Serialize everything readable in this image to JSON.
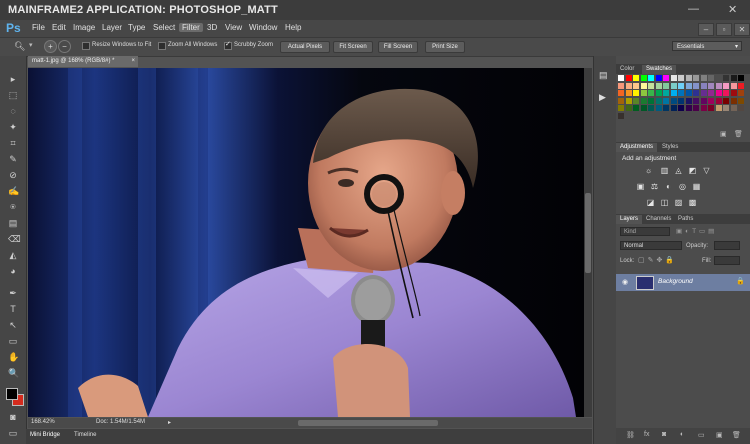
{
  "window": {
    "title": "MAINFRAME2 APPLICATION: PHOTOSHOP_MATT",
    "minimize": "—",
    "close": "✕"
  },
  "app_logo": "Ps",
  "menu": [
    "File",
    "Edit",
    "Image",
    "Layer",
    "Type",
    "Select",
    "Filter",
    "3D",
    "View",
    "Window",
    "Help"
  ],
  "menu_active": "Filter",
  "options": {
    "resize_windows": "Resize Windows to Fit",
    "zoom_all": "Zoom All Windows",
    "scrubby_zoom": "Scrubby Zoom",
    "actual_pixels": "Actual Pixels",
    "fit_screen": "Fit Screen",
    "fill_screen": "Fill Screen",
    "print_size": "Print Size",
    "workspace": "Essentials"
  },
  "document": {
    "tab_label": "matt-1.jpg @ 168% (RGB/8#) *",
    "close": "×",
    "zoom": "168.42%",
    "doc_size": "Doc: 1.54M/1.54M"
  },
  "bottom_tabs": [
    "Mini Bridge",
    "Timeline"
  ],
  "swatches_panel": {
    "tabs": [
      "Color",
      "Swatches"
    ],
    "colors": [
      "#ffffff",
      "#ff0000",
      "#ffff00",
      "#00ff00",
      "#00ffff",
      "#0000ff",
      "#ff00ff",
      "#e6e6e6",
      "#cccccc",
      "#b3b3b3",
      "#999999",
      "#808080",
      "#666666",
      "#4d4d4d",
      "#333333",
      "#1a1a1a",
      "#000000",
      "#f7977a",
      "#f9ad81",
      "#fdc68a",
      "#fff79a",
      "#c4df9b",
      "#a2d39c",
      "#82ca9d",
      "#7bcdc8",
      "#6ecff6",
      "#7ea7d8",
      "#8493ca",
      "#8882be",
      "#a187be",
      "#bc8dbf",
      "#f49ac2",
      "#f6989d",
      "#ed1c24",
      "#f26522",
      "#f7941d",
      "#fff200",
      "#8dc63f",
      "#39b54a",
      "#00a651",
      "#00a99d",
      "#00aeef",
      "#0072bc",
      "#0054a6",
      "#2e3192",
      "#662d91",
      "#92278f",
      "#ec008c",
      "#ed145b",
      "#9e0b0f",
      "#a0410d",
      "#a36209",
      "#aba000",
      "#598527",
      "#1a7b30",
      "#007236",
      "#00746b",
      "#0076a3",
      "#004b80",
      "#003471",
      "#1b1464",
      "#440e62",
      "#630460",
      "#9e005d",
      "#9e0039",
      "#790000",
      "#7b2e00",
      "#7d4900",
      "#827b00",
      "#406618",
      "#005e20",
      "#005826",
      "#005952",
      "#005b7f",
      "#003663",
      "#002157",
      "#0d004c",
      "#32004b",
      "#4b0049",
      "#7b0046",
      "#7a0026",
      "#c69c6d",
      "#998675",
      "#736357",
      "#534741",
      "#37302d"
    ]
  },
  "adjustments_panel": {
    "tabs": [
      "Adjustments",
      "Styles"
    ],
    "heading": "Add an adjustment",
    "row1": [
      "☼",
      "▥",
      "◬",
      "◩",
      "▽"
    ],
    "row2": [
      "▣",
      "⚖",
      "◐",
      "◎",
      "▦"
    ],
    "row3": [
      "◪",
      "◫",
      "▨",
      "▩"
    ]
  },
  "layers_panel": {
    "tabs": [
      "Layers",
      "Channels",
      "Paths"
    ],
    "kind": "Kind",
    "blend_mode": "Normal",
    "opacity_label": "Opacity:",
    "lock_label": "Lock:",
    "fill_label": "Fill:",
    "layer_name": "Background",
    "footer": [
      "⛓",
      "fx",
      "◙",
      "◐",
      "▭",
      "▣",
      "🗑"
    ]
  },
  "tools": [
    "▸",
    "⬚",
    "◌",
    "✦",
    "⌗",
    "✎",
    "⊘",
    "✍",
    "⍟",
    "▤",
    "⌫",
    "◭",
    "◕",
    "✒",
    "T",
    "↖",
    "▭",
    "✋",
    "🔍"
  ],
  "colors": {
    "accent": "#5fb4ef",
    "layer_selected": "#6d7ea1",
    "foreground": "#000000",
    "background": "#d42b1e"
  }
}
